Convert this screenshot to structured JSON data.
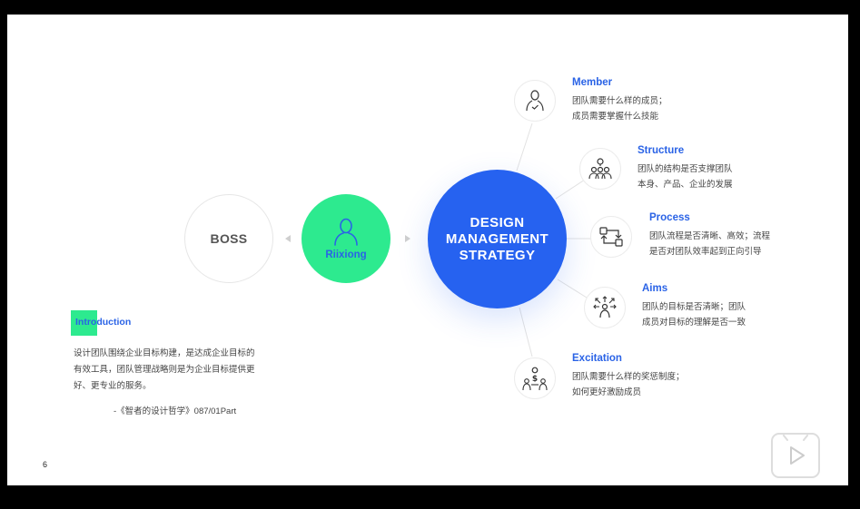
{
  "boss": {
    "label": "BOSS"
  },
  "user": {
    "label": "Riixiong"
  },
  "core": {
    "line1": "DESIGN",
    "line2": "MANAGEMENT",
    "line3": "STRATEGY"
  },
  "nodes": [
    {
      "title": "Member",
      "line1": "团队需要什么样的成员；",
      "line2": "成员需要掌握什么技能",
      "icon": "person-check-icon"
    },
    {
      "title": "Structure",
      "line1": "团队的结构是否支撑团队",
      "line2": "本身、产品、企业的发展",
      "icon": "team-structure-icon"
    },
    {
      "title": "Process",
      "line1": "团队流程是否清晰、高效；流程",
      "line2": "是否对团队效率起到正向引导",
      "icon": "process-cycle-icon"
    },
    {
      "title": "Aims",
      "line1": "团队的目标是否清晰；团队",
      "line2": "成员对目标的理解是否一致",
      "icon": "aims-arrows-icon"
    },
    {
      "title": "Excitation",
      "line1": "团队需要什么样的奖惩制度；",
      "line2": "如何更好激励成员",
      "icon": "money-team-icon"
    }
  ],
  "intro": {
    "title": "Introduction",
    "body": "设计团队围绕企业目标构建，是达成企业目标的有效工具，团队管理战略则是为企业目标提供更好、更专业的服务。",
    "quote": "-《智者的设计哲学》087/01Part"
  },
  "page_number": "6",
  "colors": {
    "accent_blue": "#2662f0",
    "accent_green": "#2dea8f",
    "title_blue": "#2a63e6"
  }
}
